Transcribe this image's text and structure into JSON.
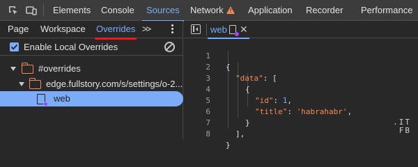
{
  "top_tabs": [
    {
      "label": "Elements"
    },
    {
      "label": "Console"
    },
    {
      "label": "Sources"
    },
    {
      "label": "Network"
    },
    {
      "label": "Application"
    },
    {
      "label": "Recorder"
    },
    {
      "label": "Performance"
    }
  ],
  "top_tab_active": "Sources",
  "left_tabs": {
    "page": "Page",
    "workspace": "Workspace",
    "overrides": "Overrides",
    "more": ">>"
  },
  "overrides": {
    "enable_label": "Enable Local Overrides",
    "checked": true
  },
  "tree": {
    "root": "#overrides",
    "folder": "edge.fullstory.com/s/settings/o-2...",
    "file": "web"
  },
  "editor": {
    "tab_label": "web",
    "line_numbers": [
      "1",
      "2",
      "3",
      "4",
      "5",
      "6",
      "7",
      "8"
    ],
    "lines": {
      "l1": "{",
      "l2_key": "\"data\"",
      "l2_rest": ": [",
      "l3": "{",
      "l4_key": "\"id\"",
      "l4_colon": ": ",
      "l4_val": "1",
      "l4_end": ",",
      "l5_key": "\"title\"",
      "l5_colon": ": ",
      "l5_val": "'habrahabr'",
      "l5_end": ",",
      "l6": "}",
      "l7": "],",
      "l8": "}"
    }
  },
  "watermark": {
    "line1": ".IT",
    "line2": "FB"
  },
  "colors": {
    "accent": "#7cacf8",
    "warning": "#f28b54",
    "active_underline": "#e81c24",
    "override_dot": "#a142f4"
  }
}
